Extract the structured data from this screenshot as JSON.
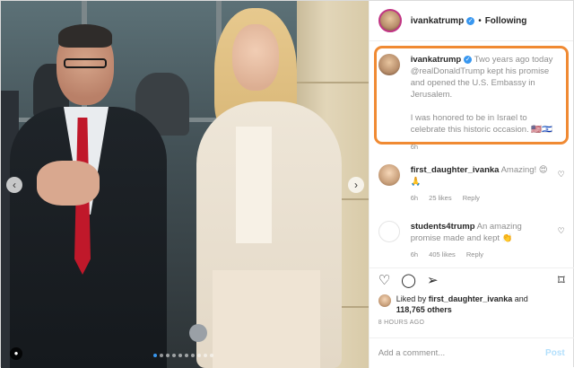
{
  "header": {
    "username": "ivankatrump",
    "separator": "•",
    "follow_status": "Following",
    "more_icon": "…"
  },
  "caption": {
    "username": "ivankatrump",
    "text_part1": " Two years ago today ",
    "mention": "@realDonaldTrump",
    "text_part2": " kept his promise and opened the U.S. Embassy in Jerusalem.",
    "text_part3": "I was honored to be in Israel to celebrate this historic occasion. 🇺🇸🇮🇱",
    "time": "6h",
    "highlight_color": "#f08a33"
  },
  "comments": [
    {
      "username": "first_daughter_ivanka",
      "text": " Amazing! 😍🙏",
      "time": "6h",
      "likes": "25 likes",
      "reply": "Reply"
    },
    {
      "username": "students4trump",
      "text": " An amazing promise made and kept 👏",
      "time": "6h",
      "likes": "405 likes",
      "reply": "Reply"
    }
  ],
  "actions": {
    "like_icon": "♡",
    "comment_icon": "◯",
    "share_icon": "➢",
    "save_icon": "⌑"
  },
  "likes": {
    "prefix": "Liked by ",
    "user": "first_daughter_ivanka",
    "and": " and ",
    "others": "118,765 others"
  },
  "timestamp": "8 HOURS AGO",
  "add_comment": {
    "placeholder": "Add a comment...",
    "post_label": "Post"
  },
  "media": {
    "prev_icon": "‹",
    "next_icon": "›",
    "tag_icon": "👤",
    "carousel_count": 10,
    "carousel_active": 1
  },
  "colors": {
    "verified": "#3897f0",
    "post_disabled": "#b2dffc"
  }
}
